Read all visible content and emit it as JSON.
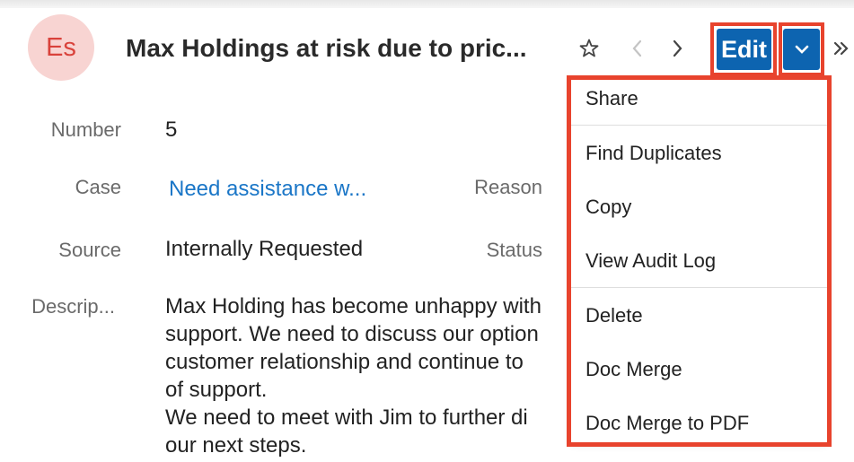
{
  "record": {
    "avatar_initials": "Es",
    "title": "Max Holdings at risk due to pric..."
  },
  "header": {
    "icons": {
      "favorite": "star-icon",
      "previous": "chevron-left-icon",
      "next": "chevron-right-icon",
      "dropdown": "chevron-down-icon",
      "more": "double-chevron-right-icon"
    },
    "edit_label": "Edit"
  },
  "fields": {
    "number_label": "Number",
    "number_value": "5",
    "case_label": "Case",
    "case_value": "Need assistance w...",
    "reason_label": "Reason",
    "source_label": "Source",
    "source_value": "Internally Requested",
    "status_label": "Status",
    "description_label": "Descrip...",
    "description_lines": [
      "Max Holding has become unhappy with",
      "support. We need to discuss our option",
      "customer relationship and continue to",
      "of support.",
      "We need to meet with Jim to further di",
      "our next steps."
    ]
  },
  "menu": {
    "items": [
      "Share",
      "Find Duplicates",
      "Copy",
      "View Audit Log",
      "Delete",
      "Doc Merge",
      "Doc Merge to PDF"
    ]
  },
  "colors": {
    "accent": "#0d64b0",
    "highlight": "#e8432d",
    "link": "#1a76c7",
    "avatar_bg": "#f8d4d2",
    "avatar_text": "#d9423b"
  }
}
